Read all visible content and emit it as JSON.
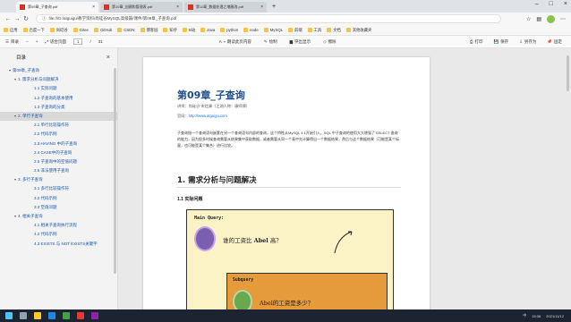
{
  "tabs": [
    {
      "label": "第09章_子查询.pdf",
      "active": true
    },
    {
      "label": "第10章_创建和管理表.pdf",
      "active": false
    },
    {
      "label": "第11章_数据处理之增删改.pdf",
      "active": false
    }
  ],
  "address": {
    "url": "file:///D:/atguigu/教学资料/尚硅谷MySQL高级篇/课件/第09章_子查询.pdf"
  },
  "bookmarks": [
    "应用",
    "百度一下",
    "尚硅谷",
    "Gitee",
    "GitHub",
    "CSDN",
    "博客园",
    "知乎",
    "B站",
    "Java",
    "python",
    "node",
    "MySQL",
    "前端",
    "工具",
    "文档",
    "其他收藏夹"
  ],
  "pdf_toolbar": {
    "left": [
      "目录",
      "−",
      "+",
      "适合页面",
      "1",
      "/",
      "31"
    ],
    "mid": [
      "朗读此页内容",
      "绘制",
      "突出显示",
      "擦除"
    ],
    "right": [
      "打印",
      "保存",
      "另存为",
      "固定"
    ]
  },
  "sidebar": {
    "title": "目录",
    "close": "×",
    "items": [
      {
        "level": 0,
        "arrow": "▾",
        "label": "第09章_子查询"
      },
      {
        "level": 1,
        "arrow": "▾",
        "label": "1. 需求分析与问题解决"
      },
      {
        "level": 2,
        "arrow": "",
        "label": "1.1 实际问题"
      },
      {
        "level": 2,
        "arrow": "",
        "label": "1.2 子查询的基本使用"
      },
      {
        "level": 2,
        "arrow": "",
        "label": "1.3 子查询的分类"
      },
      {
        "level": 1,
        "arrow": "▾",
        "label": "2. 单行子查询",
        "selected": true
      },
      {
        "level": 2,
        "arrow": "",
        "label": "2.1 单行比较操作符"
      },
      {
        "level": 2,
        "arrow": "",
        "label": "2.2 代码示例"
      },
      {
        "level": 2,
        "arrow": "",
        "label": "2.3 HAVING 中的子查询"
      },
      {
        "level": 2,
        "arrow": "",
        "label": "2.4 CASE中的子查询"
      },
      {
        "level": 2,
        "arrow": "",
        "label": "2.5 子查询中的空值问题"
      },
      {
        "level": 2,
        "arrow": "",
        "label": "2.6 非法使用子查询"
      },
      {
        "level": 1,
        "arrow": "▾",
        "label": "3. 多行子查询"
      },
      {
        "level": 2,
        "arrow": "",
        "label": "3.1 多行比较操作符"
      },
      {
        "level": 2,
        "arrow": "",
        "label": "3.2 代码示例"
      },
      {
        "level": 2,
        "arrow": "",
        "label": "3.3 空值问题"
      },
      {
        "level": 1,
        "arrow": "▾",
        "label": "4. 相关子查询"
      },
      {
        "level": 2,
        "arrow": "",
        "label": "4.1 相关子查询执行流程"
      },
      {
        "level": 2,
        "arrow": "",
        "label": "4.2 代码示例"
      },
      {
        "level": 2,
        "arrow": "",
        "label": "4.3 EXISTS 与 NOT EXISTS关键字"
      }
    ]
  },
  "document": {
    "title": "第09章_子查询",
    "meta": "讲师：尚硅谷-宋红康（江湖人称：康师傅）",
    "link_label": "官网：",
    "link_url": "http://www.atguigu.com",
    "paragraph": "子查询指一个查询语句嵌套在另一个查询语句内部的查询，这个特性从MySQL 4.1开始引入。SQL 中子查询的使用大大增强了 SELECT 查询的能力，因为很多时候查询需要从结果集中获取数据，或者需要从同一个表中先计算得出一个数据结果，然后与这个数据结果（可能是某个标量，也可能是某个集合）进行比较。",
    "h1": "1. 需求分析与问题解决",
    "h2": "1.1 实际问题",
    "figure": {
      "main_label": "Main Query:",
      "question1_pre": "谁的工资比",
      "question1_name": "Abel",
      "question1_post": "高？",
      "sub_label": "Subquery",
      "question2": "Abel的工资是多少？"
    }
  },
  "taskbar": {
    "time": "15:36",
    "date": "2021/11/12",
    "lang": "中"
  }
}
